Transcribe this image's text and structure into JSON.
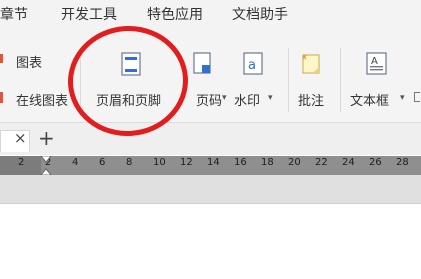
{
  "menu": {
    "tabs": [
      "章节",
      "开发工具",
      "特色应用",
      "文档助手"
    ]
  },
  "ribbon": {
    "chart_label": "图表",
    "online_chart_label": "在线图表",
    "header_footer_label": "页眉和页脚",
    "page_number_label": "页码",
    "watermark_label": "水印",
    "comment_label": "批注",
    "textbox_label": "文本框",
    "dropdown_arrow": "▾"
  },
  "tabs": {
    "close_symbol": "×",
    "add_symbol": "+"
  },
  "ruler": {
    "ticks": [
      "2",
      "2",
      "4",
      "6",
      "8",
      "10",
      "12",
      "14",
      "16",
      "18",
      "20",
      "22",
      "24",
      "26",
      "28"
    ]
  },
  "colors": {
    "highlight": "#e21d1d",
    "ribbon_bg": "#f4f4f4",
    "ruler_bg": "#8f8f8f",
    "accent_blue": "#2f6fd6"
  }
}
